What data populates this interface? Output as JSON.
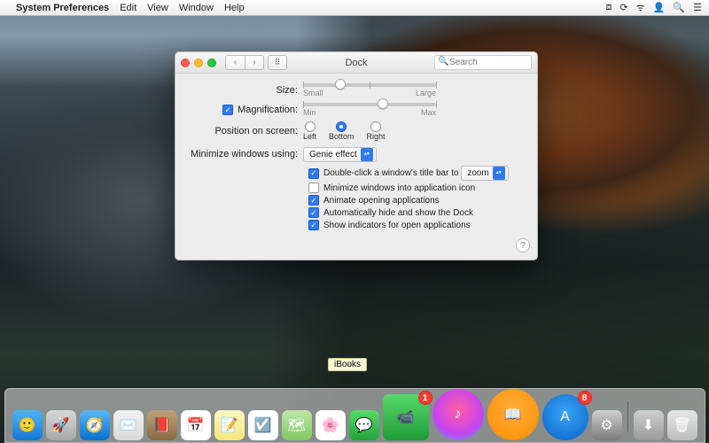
{
  "menubar": {
    "app": "System Preferences",
    "items": [
      "Edit",
      "View",
      "Window",
      "Help"
    ]
  },
  "window": {
    "title": "Dock",
    "search_placeholder": "Search",
    "size": {
      "label": "Size:",
      "min": "Small",
      "max": "Large",
      "value_pct": 28
    },
    "magnification": {
      "label": "Magnification:",
      "checked": true,
      "min": "Min",
      "max": "Max",
      "value_pct": 60
    },
    "position": {
      "label": "Position on screen:",
      "options": [
        "Left",
        "Bottom",
        "Right"
      ],
      "selected": "Bottom"
    },
    "minimize": {
      "label": "Minimize windows using:",
      "value": "Genie effect"
    },
    "dbl": {
      "checked": true,
      "label": "Double-click a window's title bar to",
      "value": "zoom"
    },
    "opts": [
      {
        "checked": false,
        "label": "Minimize windows into application icon"
      },
      {
        "checked": true,
        "label": "Animate opening applications"
      },
      {
        "checked": true,
        "label": "Automatically hide and show the Dock"
      },
      {
        "checked": true,
        "label": "Show indicators for open applications"
      }
    ]
  },
  "tooltip": "iBooks",
  "dock": {
    "items": [
      {
        "name": "finder",
        "bg": "linear-gradient(#4fb4f5,#1678d6)",
        "glyph": "🙂"
      },
      {
        "name": "launchpad",
        "bg": "linear-gradient(#d8d8d8,#a8a8a8)",
        "glyph": "🚀"
      },
      {
        "name": "safari",
        "bg": "linear-gradient(#59b7f4,#0a6fd1)",
        "glyph": "🧭"
      },
      {
        "name": "mail",
        "bg": "linear-gradient(#f2f2f2,#d9d9d9)",
        "glyph": "✉️"
      },
      {
        "name": "contacts",
        "bg": "linear-gradient(#bfa07a,#8a6a42)",
        "glyph": "📕"
      },
      {
        "name": "calendar",
        "bg": "#ffffff",
        "glyph": "📅"
      },
      {
        "name": "notes",
        "bg": "linear-gradient(#fff7c2,#f5e678)",
        "glyph": "📝"
      },
      {
        "name": "reminders",
        "bg": "#ffffff",
        "glyph": "☑️"
      },
      {
        "name": "maps",
        "bg": "linear-gradient(#bfe6a8,#7fc862)",
        "glyph": "🗺"
      },
      {
        "name": "photos",
        "bg": "#ffffff",
        "glyph": "🌸"
      },
      {
        "name": "messages",
        "bg": "linear-gradient(#57d96b,#21a53a)",
        "glyph": "💬"
      },
      {
        "name": "facetime",
        "bg": "linear-gradient(#57d96b,#1f9c36)",
        "glyph": "📹",
        "badge": "1",
        "size": "big1"
      },
      {
        "name": "itunes",
        "bg": "radial-gradient(circle at 50% 40%,#ff5fa2,#c643f0 60%,#4aa8ff)",
        "glyph": "♪",
        "size": "big2",
        "round": true
      },
      {
        "name": "ibooks",
        "bg": "radial-gradient(circle at 50% 40%,#ffb03a,#ff8a00)",
        "glyph": "📖",
        "size": "big2",
        "round": true
      },
      {
        "name": "appstore",
        "bg": "radial-gradient(circle at 50% 40%,#3aa4f6,#0663c9)",
        "glyph": "A",
        "badge": "8",
        "size": "big3",
        "round": true
      },
      {
        "name": "preferences",
        "bg": "linear-gradient(#d0d0d0,#7a7a7a)",
        "glyph": "⚙"
      }
    ],
    "right": [
      {
        "name": "downloads",
        "bg": "linear-gradient(#cfcfcf,#9a9a9a)",
        "glyph": "⬇"
      },
      {
        "name": "trash",
        "bg": "linear-gradient(#e6e6e6,#bcbcbc)",
        "glyph": "🗑"
      }
    ]
  }
}
